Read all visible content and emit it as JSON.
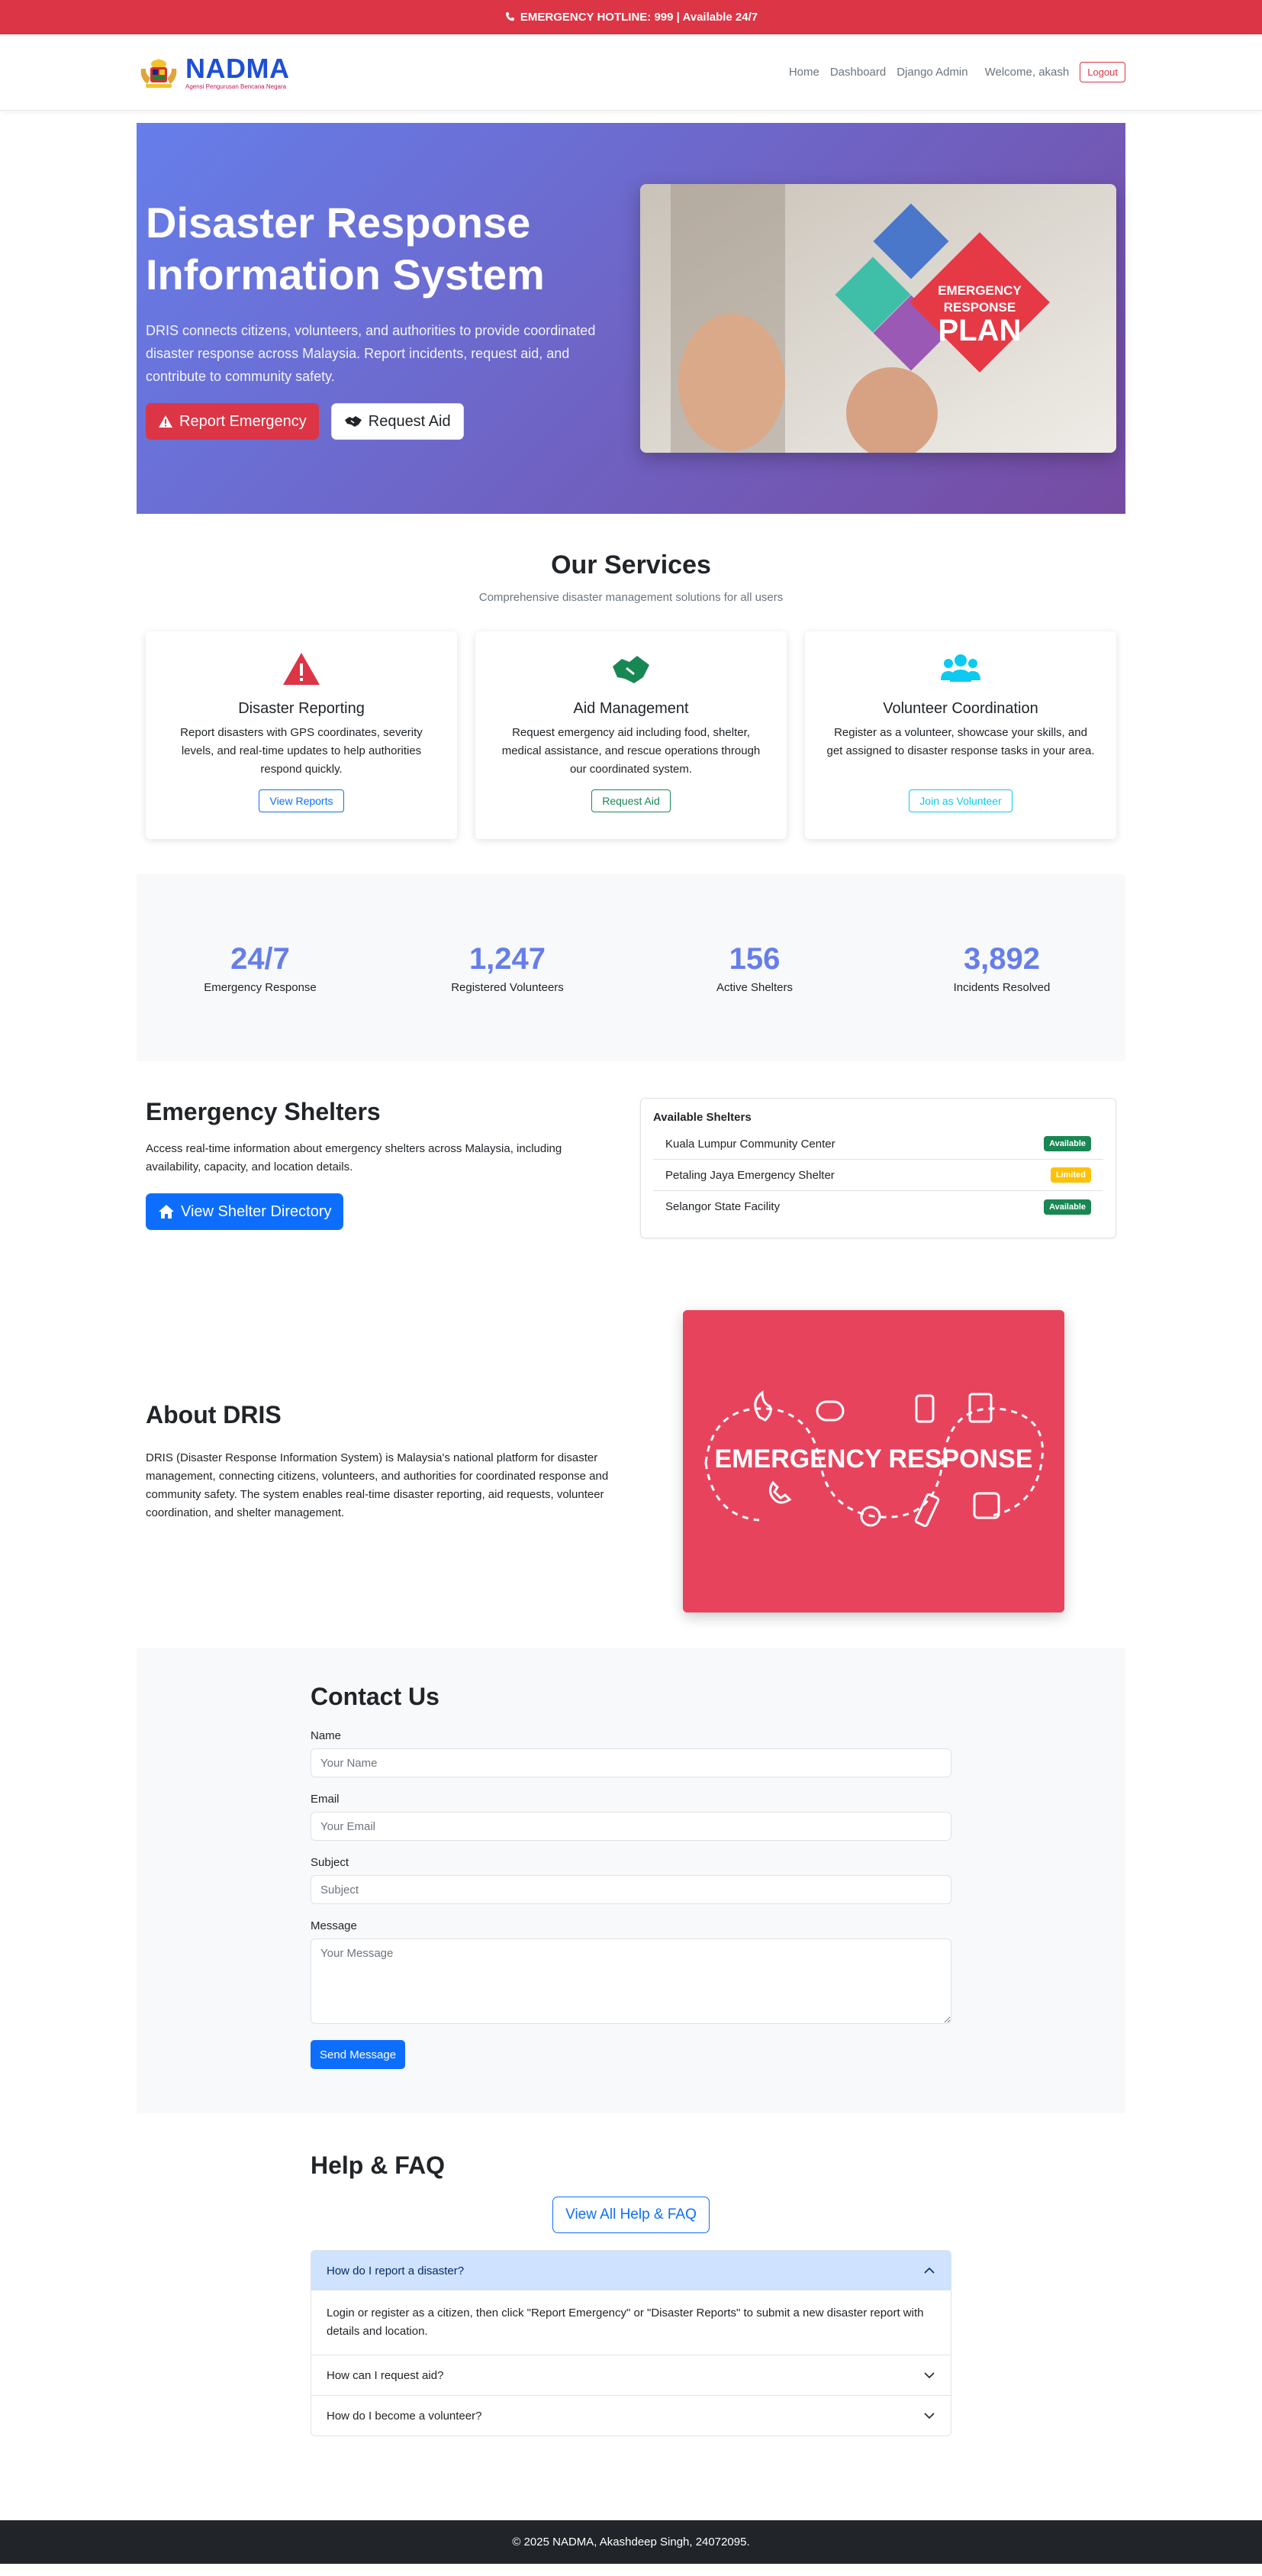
{
  "hotline": {
    "text": "EMERGENCY HOTLINE: 999 | Available 24/7",
    "color": "#dc3545"
  },
  "navbar": {
    "logo_text": "NADMA",
    "logo_subtitle": "Agensi Pengurusan Bencana Negara",
    "links": [
      "Home",
      "Dashboard",
      "Django Admin"
    ],
    "welcome": "Welcome, akash",
    "logout": "Logout"
  },
  "hero": {
    "title": "Disaster Response Information System",
    "description": "DRIS connects citizens, volunteers, and authorities to provide coordinated disaster response across Malaysia. Report incidents, request aid, and contribute to community safety.",
    "report_button": "Report Emergency",
    "aid_button": "Request Aid",
    "image_text_top": "EMERGENCY",
    "image_text_mid": "RESPONSE",
    "image_text_big": "PLAN",
    "gradient": [
      "#667eea",
      "#764ba2"
    ]
  },
  "services": {
    "title": "Our Services",
    "subtitle": "Comprehensive disaster management solutions for all users",
    "cards": [
      {
        "icon": "warning-icon",
        "title": "Disaster Reporting",
        "text": "Report disasters with GPS coordinates, severity levels, and real-time updates to help authorities respond quickly.",
        "button": "View Reports",
        "color": "#dc3545"
      },
      {
        "icon": "handshake-icon",
        "title": "Aid Management",
        "text": "Request emergency aid including food, shelter, medical assistance, and rescue operations through our coordinated system.",
        "button": "Request Aid",
        "color": "#198754"
      },
      {
        "icon": "users-icon",
        "title": "Volunteer Coordination",
        "text": "Register as a volunteer, showcase your skills, and get assigned to disaster response tasks in your area.",
        "button": "Join as Volunteer",
        "color": "#0dcaf0"
      }
    ]
  },
  "stats": [
    {
      "value": "24/7",
      "label": "Emergency Response"
    },
    {
      "value": "1,247",
      "label": "Registered Volunteers"
    },
    {
      "value": "156",
      "label": "Active Shelters"
    },
    {
      "value": "3,892",
      "label": "Incidents Resolved"
    }
  ],
  "shelters": {
    "title": "Emergency Shelters",
    "description": "Access real-time information about emergency shelters across Malaysia, including availability, capacity, and location details.",
    "button": "View Shelter Directory",
    "list_title": "Available Shelters",
    "items": [
      {
        "name": "Kuala Lumpur Community Center",
        "status": "Available",
        "color": "#198754",
        "text_color": "#ffffff"
      },
      {
        "name": "Petaling Jaya Emergency Shelter",
        "status": "Limited",
        "color": "#ffc107",
        "text_color": "#ffffff"
      },
      {
        "name": "Selangor State Facility",
        "status": "Available",
        "color": "#198754",
        "text_color": "#ffffff"
      }
    ]
  },
  "about": {
    "title": "About DRIS",
    "text": "DRIS (Disaster Response Information System) is Malaysia's national platform for disaster management, connecting citizens, volunteers, and authorities for coordinated response and community safety. The system enables real-time disaster reporting, aid requests, volunteer coordination, and shelter management.",
    "image_text": "EMERGENCY RESPONSE"
  },
  "contact": {
    "title": "Contact Us",
    "name_label": "Name",
    "name_placeholder": "Your Name",
    "email_label": "Email",
    "email_placeholder": "Your Email",
    "subject_label": "Subject",
    "subject_placeholder": "Subject",
    "message_label": "Message",
    "message_placeholder": "Your Message",
    "send": "Send Message"
  },
  "faq": {
    "title": "Help & FAQ",
    "view_all": "View All Help & FAQ",
    "items": [
      {
        "q": "How do I report a disaster?",
        "a": "Login or register as a citizen, then click \"Report Emergency\" or \"Disaster Reports\" to submit a new disaster report with details and location.",
        "open": true
      },
      {
        "q": "How can I request aid?",
        "open": false
      },
      {
        "q": "How do I become a volunteer?",
        "open": false
      }
    ]
  },
  "footer": {
    "text": "© 2025 NADMA, Akashdeep Singh, 24072095."
  }
}
